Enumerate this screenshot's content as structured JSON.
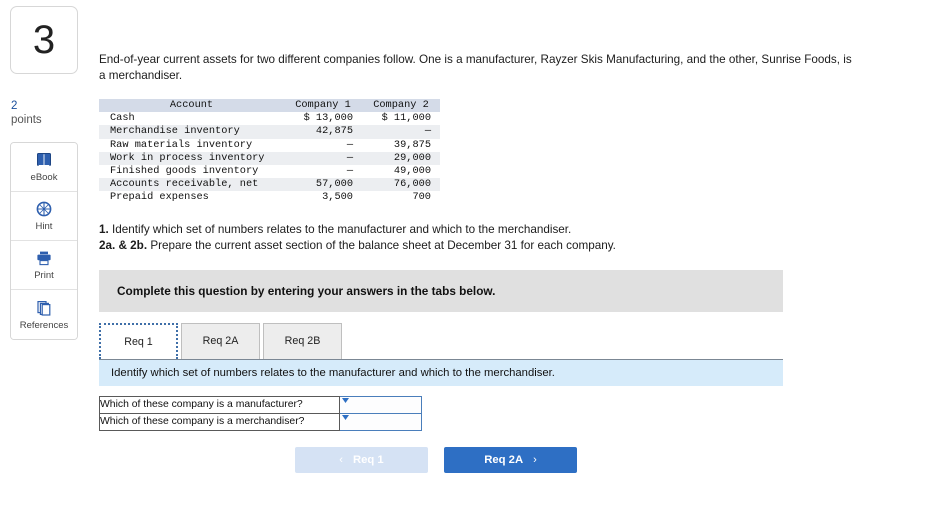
{
  "rail": {
    "question_number": "3",
    "points_value": "2",
    "points_label": "points",
    "tools": [
      {
        "label": "eBook",
        "icon": "ebook-icon"
      },
      {
        "label": "Hint",
        "icon": "hint-icon"
      },
      {
        "label": "Print",
        "icon": "print-icon"
      },
      {
        "label": "References",
        "icon": "references-icon"
      }
    ]
  },
  "intro": "End-of-year current assets for two different companies follow. One is a manufacturer, Rayzer Skis Manufacturing, and the other, Sunrise Foods, is a merchandiser.",
  "table": {
    "headers": [
      "Account",
      "Company 1",
      "Company 2"
    ],
    "rows": [
      {
        "account": "Cash",
        "company1": "$ 13,000",
        "company2": "$ 11,000"
      },
      {
        "account": "Merchandise inventory",
        "company1": "42,875",
        "company2": "—"
      },
      {
        "account": "Raw materials inventory",
        "company1": "—",
        "company2": "39,875"
      },
      {
        "account": "Work in process inventory",
        "company1": "—",
        "company2": "29,000"
      },
      {
        "account": "Finished goods inventory",
        "company1": "—",
        "company2": "49,000"
      },
      {
        "account": "Accounts receivable, net",
        "company1": "57,000",
        "company2": "76,000"
      },
      {
        "account": "Prepaid expenses",
        "company1": "3,500",
        "company2": "700"
      }
    ]
  },
  "requirements": [
    {
      "num": "1.",
      "text": " Identify which set of numbers relates to the manufacturer and which to the merchandiser."
    },
    {
      "num": "2a. & 2b.",
      "text": " Prepare the current asset section of the balance sheet at December 31 for each company."
    }
  ],
  "complete_band": "Complete this question by entering your answers in the tabs below.",
  "tabs": [
    {
      "label": "Req 1",
      "active": true
    },
    {
      "label": "Req 2A",
      "active": false
    },
    {
      "label": "Req 2B",
      "active": false
    }
  ],
  "blue_band": "Identify which set of numbers relates to the manufacturer and which to the merchandiser.",
  "answers": [
    {
      "question": "Which of these company is a manufacturer?",
      "value": ""
    },
    {
      "question": "Which of these company is a merchandiser?",
      "value": ""
    }
  ],
  "nav": {
    "prev_label": "Req 1",
    "prev_chevron": "‹",
    "next_label": "Req 2A",
    "next_chevron": "›"
  },
  "colors": {
    "accent_blue": "#2e6fc4",
    "band_grey": "#e0e0e0",
    "band_blue": "#d6ebfa",
    "table_header": "#d4dbe8",
    "table_stripe": "#eceef1"
  }
}
